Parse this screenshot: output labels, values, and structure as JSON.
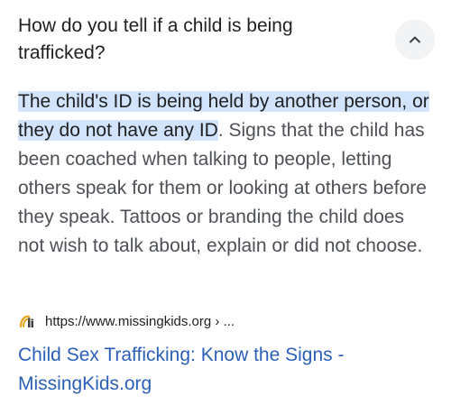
{
  "question": {
    "text": "How do you tell if a child is being trafficked?"
  },
  "answer": {
    "highlighted": "The child's ID is being held by another person, or they do not have any ID",
    "rest": ". Signs that the child has been coached when talking to people, letting others speak for them or looking at others before they speak. Tattoos or branding the child does not wish to talk about, explain or did not choose."
  },
  "source": {
    "url": "https://www.missingkids.org › ...",
    "favicon": "missingkids-logo-icon"
  },
  "result": {
    "title": "Child Sex Trafficking: Know the Signs - MissingKids.org"
  },
  "colors": {
    "highlight": "#d2e3fc",
    "link": "#2b5fb8",
    "button_bg": "#f1f3f4"
  }
}
